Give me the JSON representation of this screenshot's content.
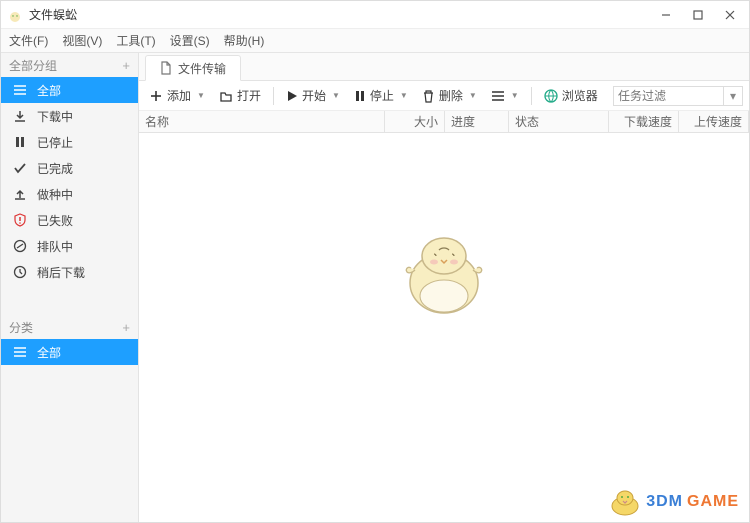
{
  "title": "文件蜈蚣",
  "menu": {
    "file": "文件(F)",
    "view": "视图(V)",
    "tools": "工具(T)",
    "settings": "设置(S)",
    "help": "帮助(H)"
  },
  "sidebar": {
    "group_all": "全部分组",
    "items": [
      {
        "label": "全部"
      },
      {
        "label": "下载中"
      },
      {
        "label": "已停止"
      },
      {
        "label": "已完成"
      },
      {
        "label": "做种中"
      },
      {
        "label": "已失败"
      },
      {
        "label": "排队中"
      },
      {
        "label": "稍后下载"
      }
    ],
    "categories_label": "分类",
    "cat_all": "全部"
  },
  "tab": {
    "label": "文件传输"
  },
  "toolbar": {
    "add": "添加",
    "open": "打开",
    "start": "开始",
    "stop": "停止",
    "delete": "删除",
    "browser": "浏览器",
    "filter_placeholder": "任务过滤"
  },
  "columns": {
    "name": "名称",
    "size": "大小",
    "progress": "进度",
    "status": "状态",
    "dlspeed": "下载速度",
    "ulspeed": "上传速度"
  },
  "watermark": {
    "a": "3DM",
    "b": "GAME"
  }
}
